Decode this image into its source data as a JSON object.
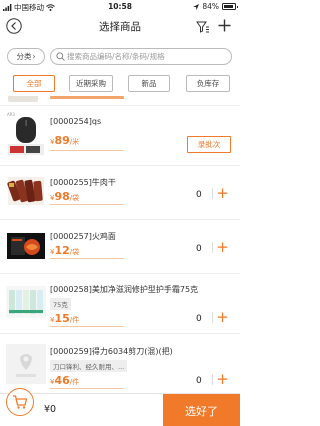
{
  "status_bar": {
    "carrier": "中国移动",
    "time": "10:58",
    "battery": "84%"
  },
  "nav": {
    "title": "选择商品"
  },
  "search": {
    "category_label": "分类",
    "category_arrow": "›",
    "placeholder": "搜索商品编码/名称/条码/规格"
  },
  "tabs": [
    {
      "label": "全部",
      "active": true
    },
    {
      "label": "近期采购",
      "active": false
    },
    {
      "label": "新品",
      "active": false
    },
    {
      "label": "负库存",
      "active": false
    }
  ],
  "products": [
    {
      "name": "[0000254]qs",
      "price_symbol": "¥",
      "price": "89",
      "unit": "/米",
      "action": "录批次",
      "thumb_icon": "mouse-icon"
    },
    {
      "name": "[0000255]牛肉干",
      "price_symbol": "¥",
      "price": "98",
      "unit": "/袋",
      "qty": "0",
      "add": "+",
      "thumb_icon": "jerky-icon"
    },
    {
      "name": "[0000257]火鸡面",
      "price_symbol": "¥",
      "price": "12",
      "unit": "/袋",
      "qty": "0",
      "add": "+",
      "thumb_icon": "noodle-icon"
    },
    {
      "name": "[0000258]美加净滋润修护型护手霜75克",
      "spec": "75克",
      "price_symbol": "¥",
      "price": "15",
      "unit": "/件",
      "qty": "0",
      "add": "+",
      "thumb_icon": "cream-tubes-icon"
    },
    {
      "name": "[0000259]得力6034剪刀(混)(把)",
      "spec": "刀口锋利、经久耐用、...",
      "price_symbol": "¥",
      "price": "46",
      "unit": "/件",
      "qty": "0",
      "add": "+",
      "thumb_icon": "placeholder-image-icon"
    }
  ],
  "bottom": {
    "total": "¥0",
    "confirm_label": "选好了"
  },
  "colors": {
    "accent": "#f0792a"
  }
}
